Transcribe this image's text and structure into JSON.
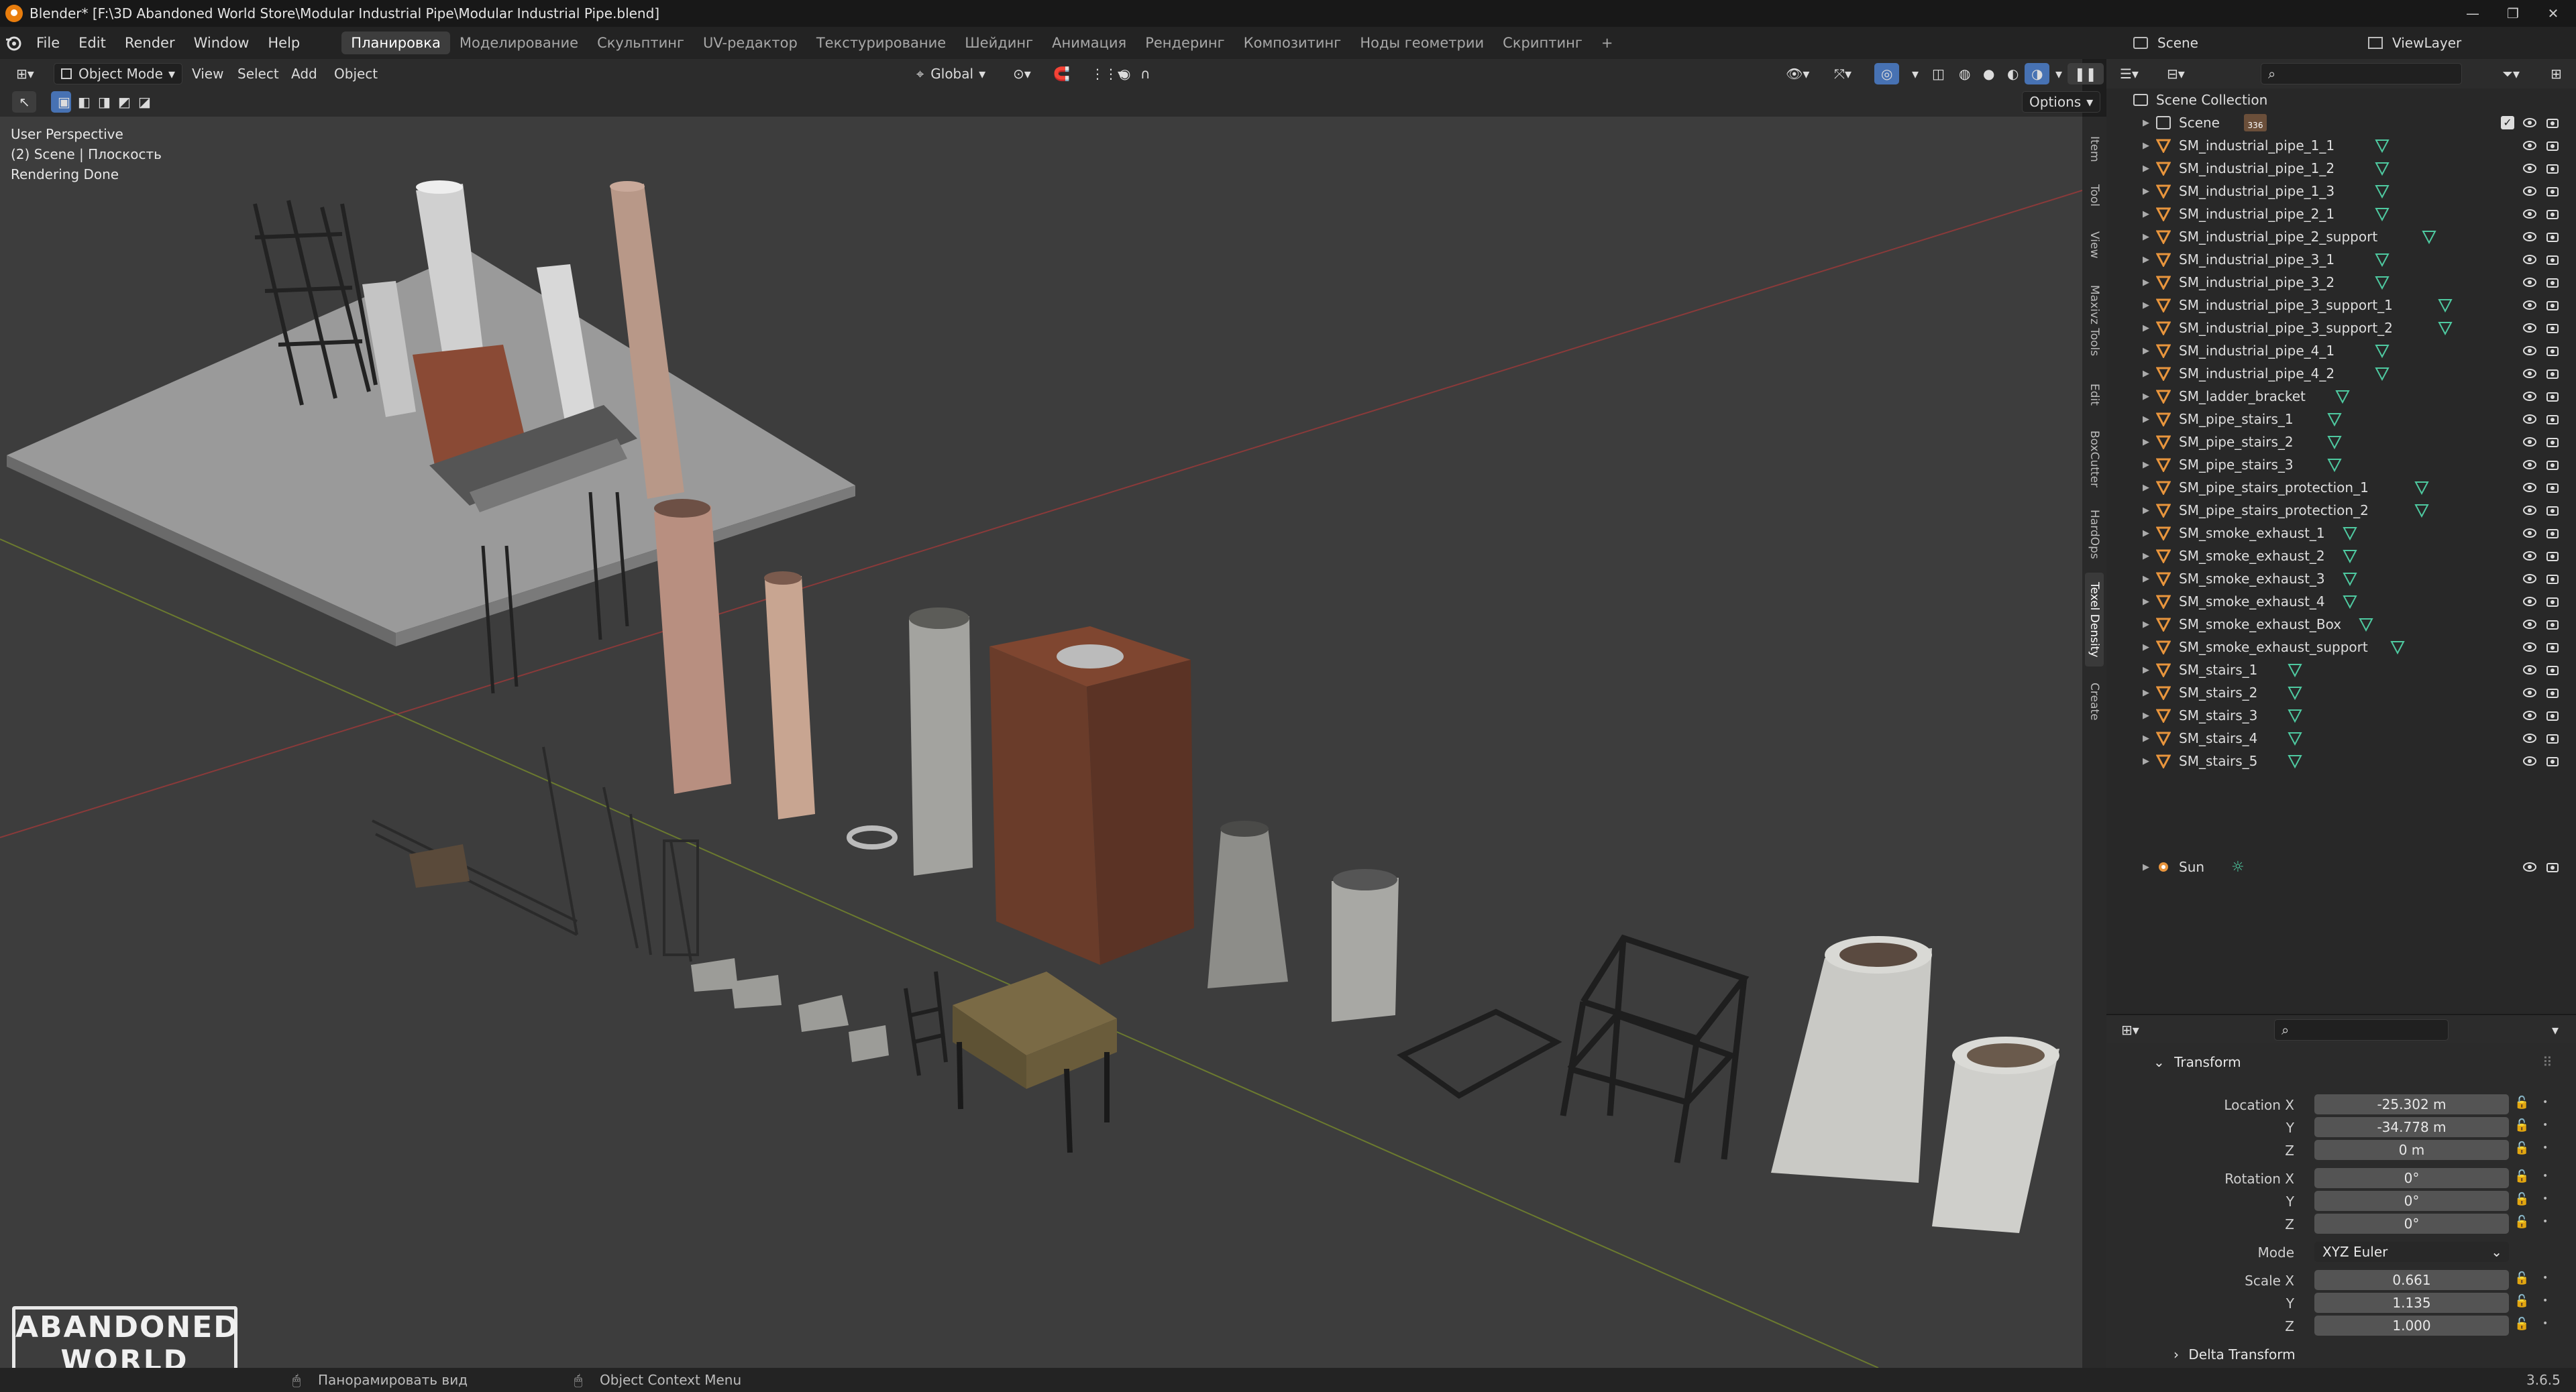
{
  "window": {
    "title": "Blender* [F:\\3D Abandoned World Store\\Modular Industrial Pipe\\Modular Industrial Pipe.blend]",
    "controls": [
      "—",
      "❐",
      "✕"
    ]
  },
  "menubar": {
    "menus": [
      "File",
      "Edit",
      "Render",
      "Window",
      "Help"
    ],
    "workspaces": [
      "Планировка",
      "Моделирование",
      "Скульптинг",
      "UV-редактор",
      "Текстурирование",
      "Шейдинг",
      "Анимация",
      "Рендеринг",
      "Композитинг",
      "Ноды геометрии",
      "Скриптинг"
    ],
    "active_workspace": "Планировка",
    "add_workspace": "+"
  },
  "scene_selector": {
    "label": "Scene",
    "viewlayer": "ViewLayer"
  },
  "viewport_header": {
    "mode": "Object Mode",
    "menus": [
      "View",
      "Select",
      "Add",
      "Object"
    ],
    "transform_orientation": "Global",
    "options": "Options"
  },
  "viewport": {
    "overlay_lines": [
      "User Perspective",
      "(2) Scene | Плоскость",
      "Rendering Done"
    ],
    "logo_text": [
      "ABANDONED",
      "WORLD"
    ]
  },
  "sidebar_tabs": [
    "Item",
    "Tool",
    "View",
    "Maxivz Tools",
    "Edit",
    "BoxCutter",
    "HardOps",
    "Texel Density",
    "Create"
  ],
  "active_sidebar_tab": "Texel Density",
  "outliner": {
    "collection": "Scene Collection",
    "scene_row": {
      "name": "Scene",
      "badge": "336"
    },
    "items": [
      "SM_industrial_pipe_1_1",
      "SM_industrial_pipe_1_2",
      "SM_industrial_pipe_1_3",
      "SM_industrial_pipe_2_1",
      "SM_industrial_pipe_2_support",
      "SM_industrial_pipe_3_1",
      "SM_industrial_pipe_3_2",
      "SM_industrial_pipe_3_support_1",
      "SM_industrial_pipe_3_support_2",
      "SM_industrial_pipe_4_1",
      "SM_industrial_pipe_4_2",
      "SM_ladder_bracket",
      "SM_pipe_stairs_1",
      "SM_pipe_stairs_2",
      "SM_pipe_stairs_3",
      "SM_pipe_stairs_protection_1",
      "SM_pipe_stairs_protection_2",
      "SM_smoke_exhaust_1",
      "SM_smoke_exhaust_2",
      "SM_smoke_exhaust_3",
      "SM_smoke_exhaust_4",
      "SM_smoke_exhaust_Box",
      "SM_smoke_exhaust_support",
      "SM_stairs_1",
      "SM_stairs_2",
      "SM_stairs_3",
      "SM_stairs_4",
      "SM_stairs_5"
    ],
    "sun": "Sun"
  },
  "properties": {
    "section": "Transform",
    "location_label": "Location X",
    "location": {
      "x": "-25.302 m",
      "y": "-34.778 m",
      "z": "0 m"
    },
    "rotation_label": "Rotation X",
    "rotation": {
      "x": "0°",
      "y": "0°",
      "z": "0°"
    },
    "mode_label": "Mode",
    "mode": "XYZ Euler",
    "scale_label": "Scale X",
    "scale": {
      "x": "0.661",
      "y": "1.135",
      "z": "1.000"
    },
    "axis_y": "Y",
    "axis_z": "Z",
    "delta": "Delta Transform"
  },
  "statusbar": {
    "hint1": "Панорамировать вид",
    "hint2": "Object Context Menu",
    "version": "3.6.5"
  },
  "colors": {
    "accent": "#4772b3",
    "mesh_icon": "#e8953d",
    "data_icon": "#4ec9a0",
    "viewport_bg": "#3d3d3d"
  }
}
